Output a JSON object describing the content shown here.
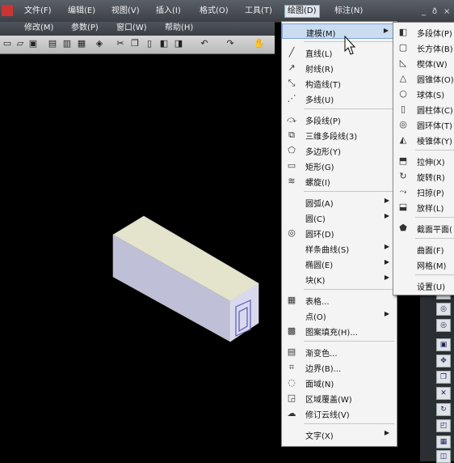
{
  "menubar": {
    "row1": [
      "文件(F)",
      "编辑(E)",
      "视图(V)",
      "插入(I)",
      "格式(O)",
      "工具(T)",
      "绘图(D)",
      "标注(N)"
    ],
    "row2": [
      "修改(M)",
      "参数(P)",
      "窗口(W)",
      "帮助(H)"
    ],
    "window_controls": [
      "_",
      "ð",
      "×"
    ]
  },
  "draw_menu": {
    "items": [
      {
        "label": "建模(M)",
        "icon": "",
        "arrow": true,
        "highlight": true
      },
      {
        "label": "直线(L)",
        "icon": "line-icon"
      },
      {
        "label": "射线(R)",
        "icon": "ray-icon"
      },
      {
        "label": "构造线(T)",
        "icon": "xline-icon"
      },
      {
        "label": "多线(U)",
        "icon": "mline-icon"
      },
      {
        "label": "多段线(P)",
        "icon": "polyline-icon"
      },
      {
        "label": "三维多段线(3)",
        "icon": "3dpoly-icon"
      },
      {
        "label": "多边形(Y)",
        "icon": "polygon-icon"
      },
      {
        "label": "矩形(G)",
        "icon": "rectangle-icon"
      },
      {
        "label": "螺旋(I)",
        "icon": "helix-icon"
      },
      {
        "label": "圆弧(A)",
        "icon": "",
        "arrow": true
      },
      {
        "label": "圆(C)",
        "icon": "",
        "arrow": true
      },
      {
        "label": "圆环(D)",
        "icon": "donut-icon"
      },
      {
        "label": "样条曲线(S)",
        "icon": "",
        "arrow": true
      },
      {
        "label": "椭圆(E)",
        "icon": "",
        "arrow": true
      },
      {
        "label": "块(K)",
        "icon": "",
        "arrow": true
      },
      {
        "label": "表格...",
        "icon": "table-icon"
      },
      {
        "label": "点(O)",
        "icon": "",
        "arrow": true
      },
      {
        "label": "图案填充(H)...",
        "icon": "hatch-icon"
      },
      {
        "label": "渐变色...",
        "icon": "gradient-icon"
      },
      {
        "label": "边界(B)...",
        "icon": "boundary-icon"
      },
      {
        "label": "面域(N)",
        "icon": "region-icon"
      },
      {
        "label": "区域覆盖(W)",
        "icon": "wipeout-icon"
      },
      {
        "label": "修订云线(V)",
        "icon": "revcloud-icon"
      },
      {
        "label": "文字(X)",
        "icon": "",
        "arrow": true
      }
    ]
  },
  "modeling_submenu": {
    "items": [
      {
        "label": "多段体(P)"
      },
      {
        "label": "长方体(B)"
      },
      {
        "label": "楔体(W)"
      },
      {
        "label": "圆锥体(O)"
      },
      {
        "label": "球体(S)"
      },
      {
        "label": "圆柱体(C)"
      },
      {
        "label": "圆环体(T)"
      },
      {
        "label": "棱锥体(Y)"
      },
      {
        "label": "拉伸(X)"
      },
      {
        "label": "旋转(R)"
      },
      {
        "label": "扫掠(P)"
      },
      {
        "label": "放样(L)"
      },
      {
        "label": "截面平面("
      },
      {
        "label": "曲面(F)"
      },
      {
        "label": "网格(M)"
      },
      {
        "label": "设置(U)"
      }
    ]
  }
}
